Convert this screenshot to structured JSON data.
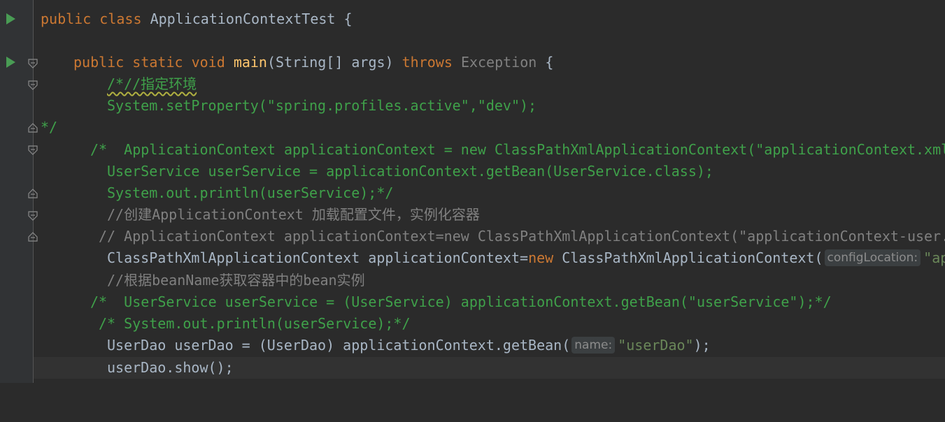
{
  "editor": {
    "class_decl": {
      "kw_public": "public",
      "kw_class": "class",
      "name": "ApplicationContextTest",
      "brace": " {"
    },
    "main_decl": {
      "kw_public": "public",
      "kw_static": "static",
      "kw_void": "void",
      "name": "main",
      "params": "(String[] args) ",
      "kw_throws": "throws",
      "exception": "Exception",
      "brace": " {"
    },
    "lines": {
      "l3": "/*//指定环境",
      "l4": "System.setProperty(\"spring.profiles.active\",\"dev\");",
      "l5": "*/",
      "l6": "/*  ApplicationContext applicationContext = new ClassPathXmlApplicationContext(\"applicationContext.xml",
      "l7": "UserService userService = applicationContext.getBean(UserService.class);",
      "l8": "System.out.println(userService);*/",
      "l9": "//创建ApplicationContext 加载配置文件，实例化容器",
      "l10": "// ApplicationContext applicationContext=new ClassPathXmlApplicationContext(\"applicationContext-user.",
      "l11_a": "ClassPathXmlApplicationContext applicationContext=",
      "l11_new": "new",
      "l11_b": " ClassPathXmlApplicationContext(",
      "l11_hint": "configLocation:",
      "l11_str": "\"ap",
      "l12": "//根据beanName获取容器中的bean实例",
      "l13": "/*  UserService userService = (UserService) applicationContext.getBean(\"userService\");*/",
      "l14": "/* System.out.println(userService);*/",
      "l15_a": "UserDao userDao = (UserDao) applicationContext.getBean(",
      "l15_hint": "name:",
      "l15_str": "\"userDao\"",
      "l15_end": ");",
      "l16": "userDao.show();"
    }
  }
}
